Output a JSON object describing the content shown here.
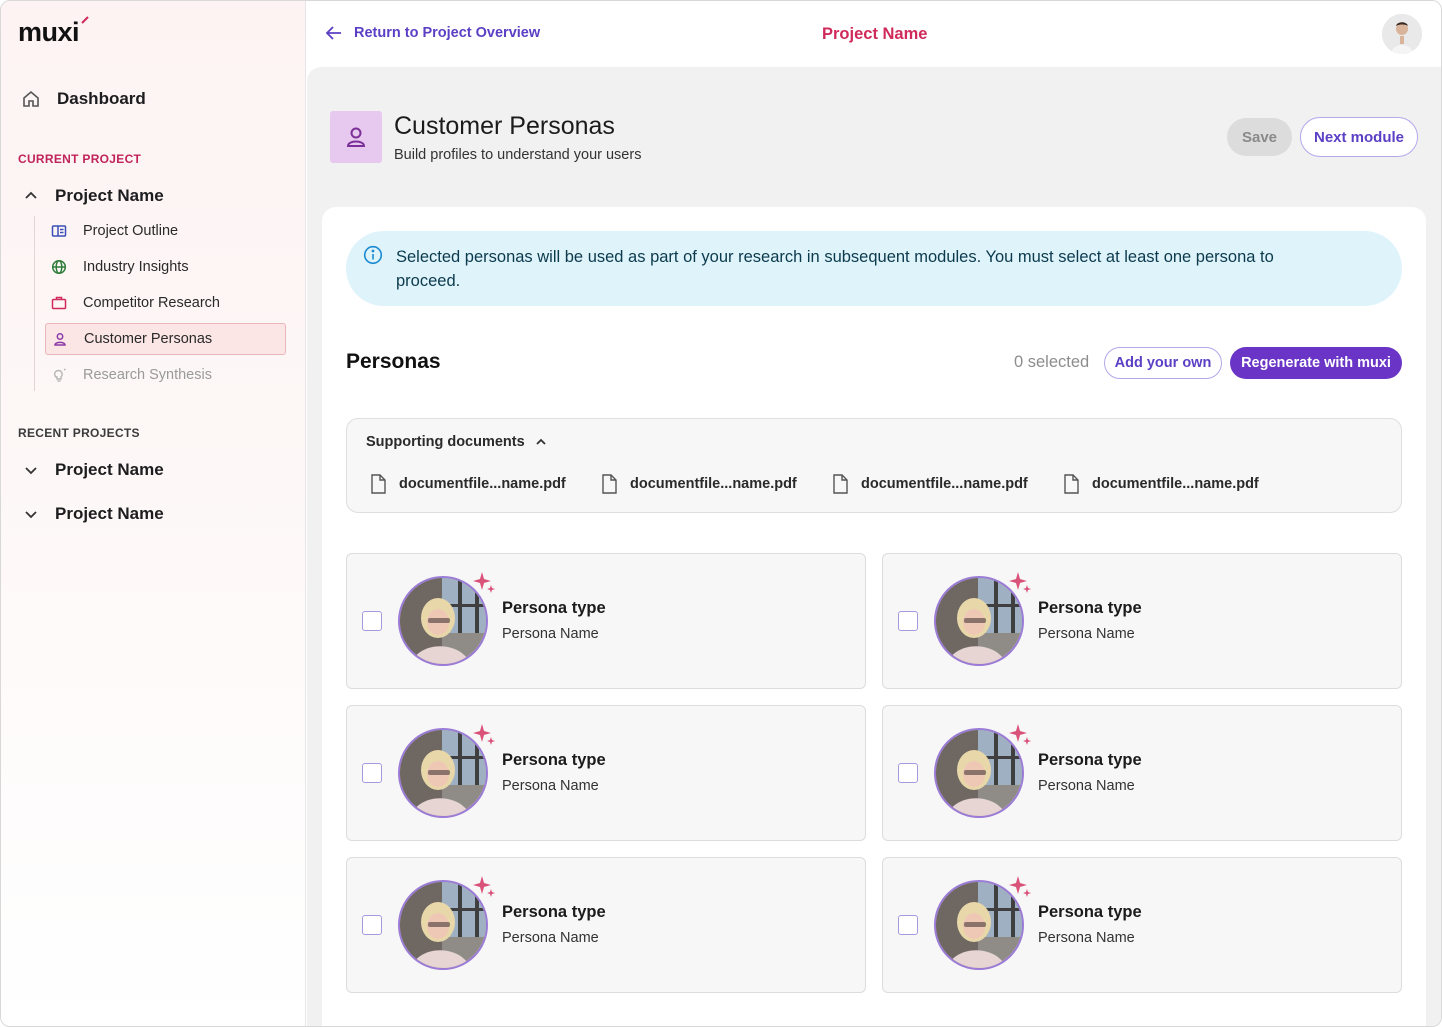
{
  "sidebar": {
    "logo": "muxi",
    "dashboard_label": "Dashboard",
    "current_project_label": "CURRENT PROJECT",
    "current_project_name": "Project Name",
    "items": [
      {
        "label": "Project Outline",
        "icon": "outline-icon"
      },
      {
        "label": "Industry Insights",
        "icon": "globe-icon"
      },
      {
        "label": "Competitor Research",
        "icon": "briefcase-icon"
      },
      {
        "label": "Customer Personas",
        "icon": "person-icon",
        "active": true
      },
      {
        "label": "Research Synthesis",
        "icon": "lightbulb-icon",
        "disabled": true
      }
    ],
    "recent_projects_label": "RECENT PROJECTS",
    "recent_projects": [
      "Project Name",
      "Project Name"
    ]
  },
  "header": {
    "back_link": "Return to Project Overview",
    "project_name": "Project Name"
  },
  "module": {
    "title": "Customer Personas",
    "subtitle": "Build profiles to understand your users",
    "save_label": "Save",
    "next_label": "Next module"
  },
  "info": {
    "text": "Selected personas will be used as part of your research in subsequent modules. You must select at least one persona to proceed."
  },
  "personas": {
    "title": "Personas",
    "selected_count": "0 selected",
    "add_label": "Add your own",
    "regen_label": "Regenerate with muxi",
    "docs_title": "Supporting documents",
    "documents": [
      "documentfile...name.pdf",
      "documentfile...name.pdf",
      "documentfile...name.pdf",
      "documentfile...name.pdf"
    ],
    "cards": [
      {
        "type": "Persona type",
        "name": "Persona Name"
      },
      {
        "type": "Persona type",
        "name": "Persona Name"
      },
      {
        "type": "Persona type",
        "name": "Persona Name"
      },
      {
        "type": "Persona type",
        "name": "Persona Name"
      },
      {
        "type": "Persona type",
        "name": "Persona Name"
      },
      {
        "type": "Persona type",
        "name": "Persona Name"
      }
    ]
  },
  "colors": {
    "accent_purple": "#6a35c6",
    "accent_pink": "#d02a5a",
    "info_bg": "#dff3fb"
  }
}
